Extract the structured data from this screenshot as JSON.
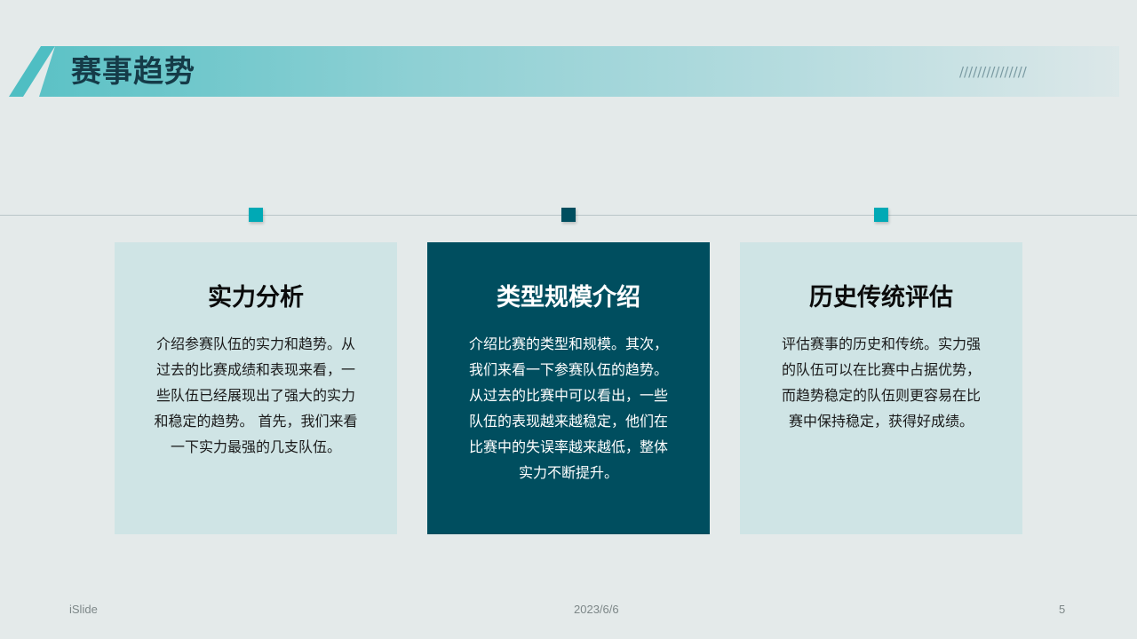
{
  "slide": {
    "title": "赛事趋势",
    "decoration": "///////////////"
  },
  "cards": [
    {
      "title": "实力分析",
      "body": "介绍参赛队伍的实力和趋势。从过去的比赛成绩和表现来看，一些队伍已经展现出了强大的实力和稳定的趋势。 首先，我们来看一下实力最强的几支队伍。"
    },
    {
      "title": "类型规模介绍",
      "body": "介绍比赛的类型和规模。其次，我们来看一下参赛队伍的趋势。从过去的比赛中可以看出，一些队伍的表现越来越稳定，他们在比赛中的失误率越来越低，整体实力不断提升。"
    },
    {
      "title": "历史传统评估",
      "body": "评估赛事的历史和传统。实力强的队伍可以在比赛中占据优势，而趋势稳定的队伍则更容易在比赛中保持稳定，获得好成绩。"
    }
  ],
  "footer": {
    "brand": "iSlide",
    "date": "2023/6/6",
    "page": "5"
  },
  "colors": {
    "accent_teal": "#00a9b5",
    "dark_teal": "#004e5f",
    "light_card": "#cfe4e5",
    "background": "#e4eaea"
  }
}
